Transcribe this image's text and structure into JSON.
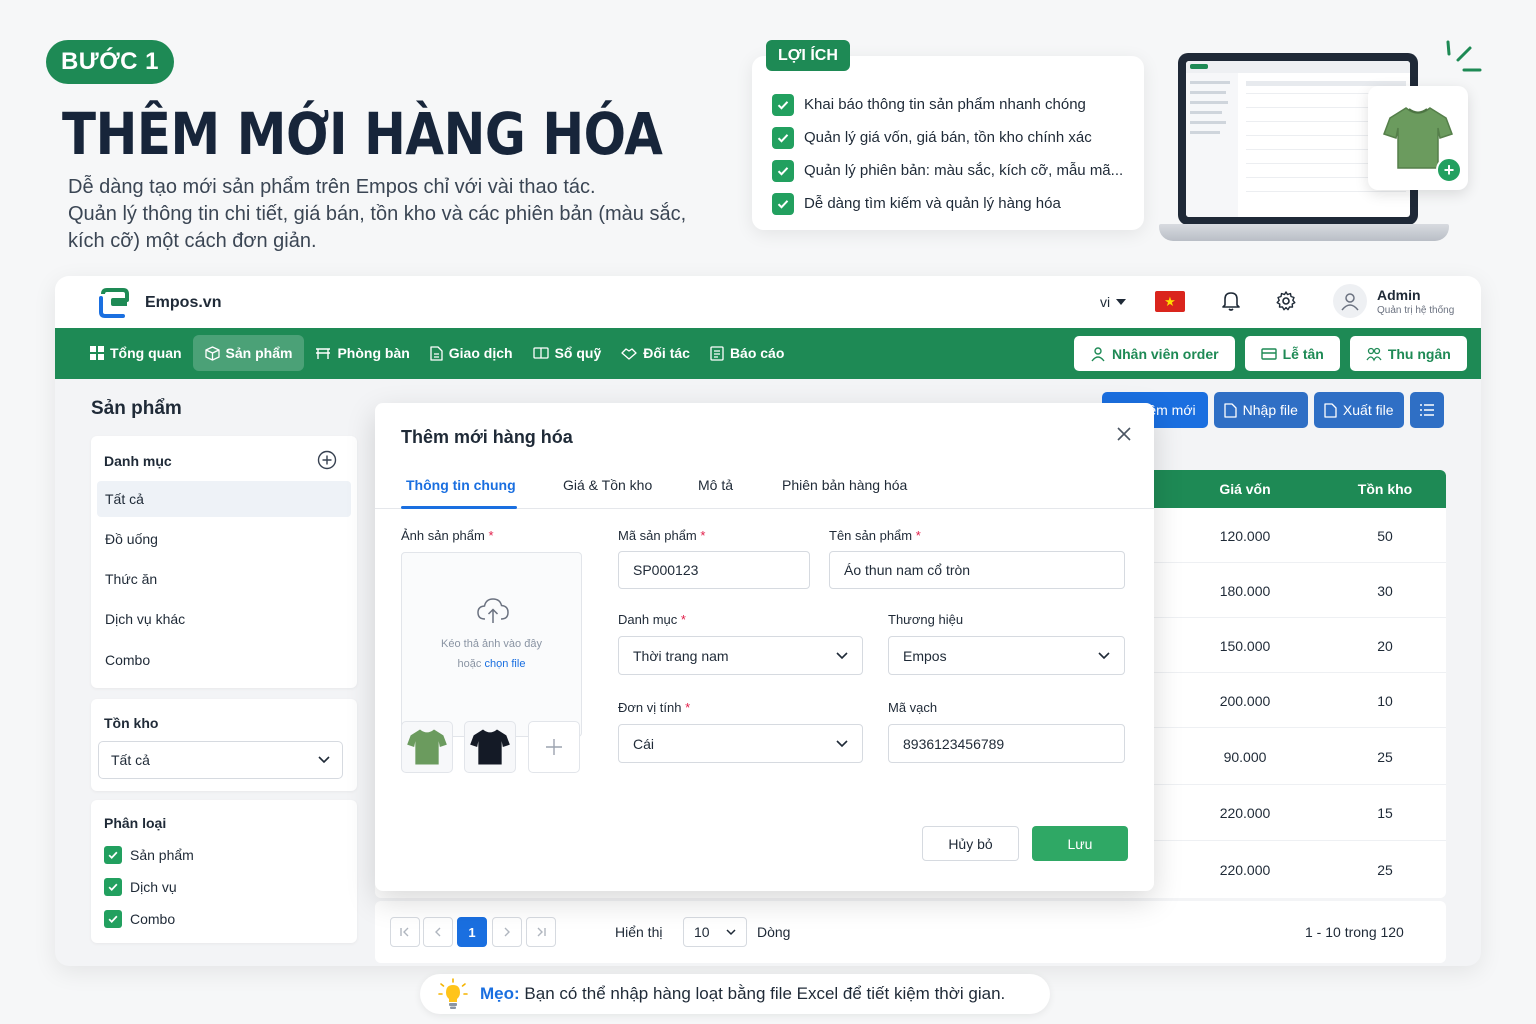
{
  "hero": {
    "step": "BƯỚC 1",
    "title": "THÊM MỚI HÀNG HÓA",
    "desc_line1": "Dễ dàng tạo mới sản phẩm trên Empos chỉ với vài thao tác.",
    "desc_line2": "Quản lý thông tin chi tiết, giá bán, tồn kho và các phiên bản (màu sắc, kích cỡ) một cách đơn giản."
  },
  "benefits": {
    "tag": "LỢI ÍCH",
    "items": [
      "Khai báo thông tin sản phẩm nhanh chóng",
      "Quản lý giá vốn, giá bán, tồn kho chính xác",
      "Quản lý phiên bản: màu sắc, kích cỡ, mẫu mã...",
      "Dễ dàng tìm kiếm và quản lý hàng hóa"
    ]
  },
  "header": {
    "brand": "Empos.vn",
    "lang": "vi",
    "user_name": "Admin",
    "user_role": "Quản trị hệ thống"
  },
  "nav": {
    "items": [
      "Tổng quan",
      "Sản phẩm",
      "Phòng bàn",
      "Giao dịch",
      "Sổ quỹ",
      "Đối tác",
      "Báo cáo"
    ],
    "right": [
      "Nhân viên order",
      "Lễ tân",
      "Thu ngân"
    ]
  },
  "page": {
    "title": "Sản phẩm",
    "category": {
      "heading": "Danh mục",
      "items": [
        "Tất cả",
        "Đồ uống",
        "Thức ăn",
        "Dịch vụ khác",
        "Combo"
      ]
    },
    "stock": {
      "heading": "Tồn kho",
      "value": "Tất cả"
    },
    "type": {
      "heading": "Phân loại",
      "items": [
        "Sản phẩm",
        "Dịch vụ",
        "Combo"
      ]
    },
    "actions": {
      "add": "Thêm mới",
      "import": "Nhập file",
      "export": "Xuất file"
    },
    "table": {
      "headers": {
        "cost": "Giá vốn",
        "stock": "Tồn kho"
      },
      "rows": [
        {
          "cost": "120.000",
          "stock": "50"
        },
        {
          "cost": "180.000",
          "stock": "30"
        },
        {
          "cost": "150.000",
          "stock": "20"
        },
        {
          "cost": "200.000",
          "stock": "10"
        },
        {
          "cost": "90.000",
          "stock": "25"
        },
        {
          "cost": "220.000",
          "stock": "15"
        },
        {
          "cost": "220.000",
          "stock": "25"
        }
      ]
    },
    "pager": {
      "current": "1",
      "show_label": "Hiển thị",
      "page_size": "10",
      "rows_label": "Dòng",
      "summary": "1 - 10 trong 120"
    }
  },
  "modal": {
    "title": "Thêm mới hàng hóa",
    "tabs": [
      "Thông tin chung",
      "Giá & Tồn kho",
      "Mô tả",
      "Phiên bản hàng hóa"
    ],
    "image_label": "Ảnh sản phẩm",
    "dropzone_line1": "Kéo thả ảnh vào đây",
    "dropzone_prefix": "hoặc",
    "dropzone_link": "chọn file",
    "sku_label": "Mã sản phẩm",
    "sku_value": "SP000123",
    "name_label": "Tên sản phẩm",
    "name_value": "Áo thun nam cổ tròn",
    "category_label": "Danh mục",
    "category_value": "Thời trang nam",
    "brand_label": "Thương hiệu",
    "brand_value": "Empos",
    "unit_label": "Đơn vị tính",
    "unit_value": "Cái",
    "barcode_label": "Mã vạch",
    "barcode_value": "8936123456789",
    "cancel": "Hủy bỏ",
    "save": "Lưu"
  },
  "tip": {
    "label": "Mẹo:",
    "text": "Bạn có thể nhập hàng loạt bằng file Excel để tiết kiệm thời gian."
  },
  "colors": {
    "brand_green": "#1e8a55",
    "primary_blue": "#1a6fe0",
    "save_green": "#2fa865"
  }
}
